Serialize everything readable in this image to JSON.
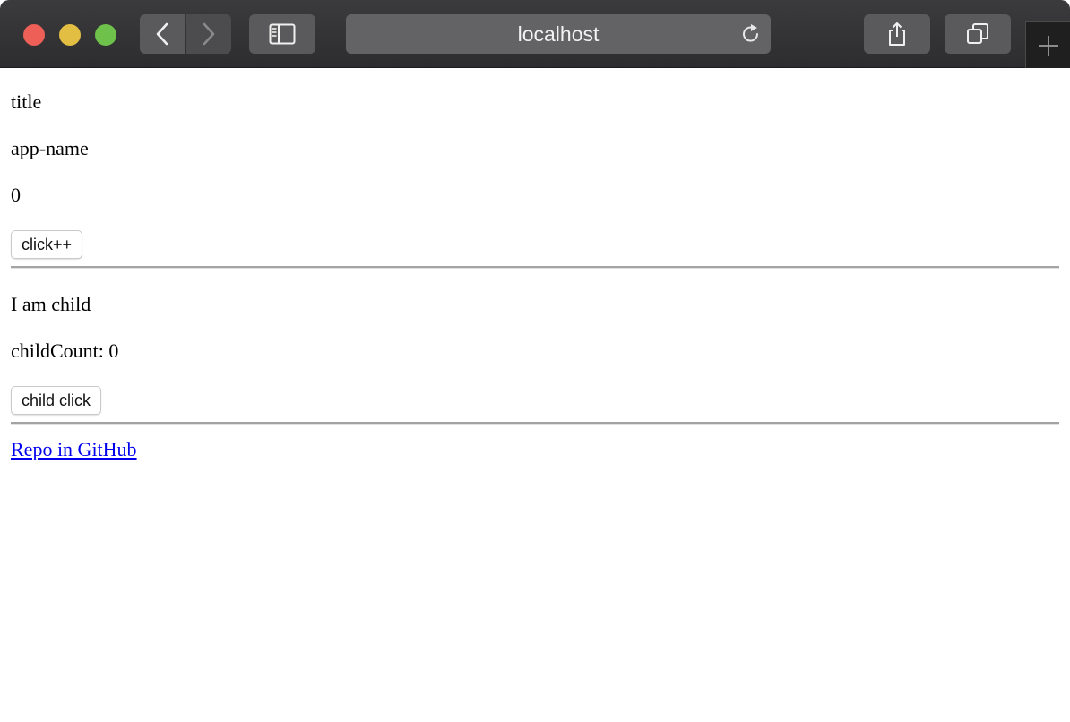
{
  "browser": {
    "address": "localhost",
    "icons": {
      "back": "chevron-left-icon",
      "forward": "chevron-right-icon",
      "sidebar": "sidebar-icon",
      "reload": "reload-icon",
      "share": "share-icon",
      "tabs": "tabs-overview-icon",
      "new_tab": "plus-icon"
    },
    "colors": {
      "close": "#ee5f58",
      "minimize": "#e2be43",
      "maximize": "#6ec14a"
    }
  },
  "page": {
    "title": "title",
    "app_name": "app-name",
    "count": "0",
    "click_button": "click++",
    "child_heading": "I am child",
    "child_count": "childCount: 0",
    "child_button": "child click",
    "repo_link": "Repo in GitHub",
    "link_color": "#0000ee"
  }
}
